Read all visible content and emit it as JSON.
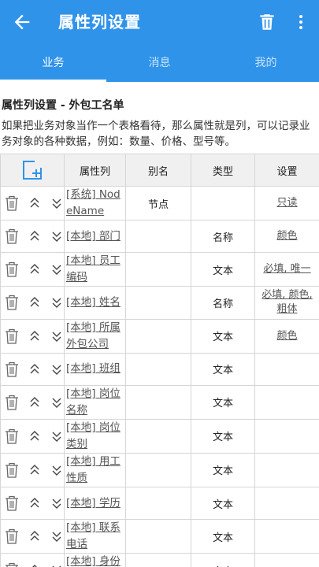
{
  "appbar": {
    "title": "属性列设置"
  },
  "tabs": [
    {
      "label": "业务",
      "active": true
    },
    {
      "label": "消息",
      "active": false
    },
    {
      "label": "我的",
      "active": false
    }
  ],
  "heading": "属性列设置 - 外包工名单",
  "description": "如果把业务对象当作一个表格看待，那么属性就是列，可以记录业务对象的各种数据，例如：数量、价格、型号等。",
  "table": {
    "headers": [
      "属性列",
      "别名",
      "类型",
      "设置"
    ],
    "rows": [
      {
        "name": "[系统] NodeName",
        "alias": "节点",
        "type": "",
        "settings": "只读"
      },
      {
        "name": "[本地] 部门",
        "alias": "",
        "type": "名称",
        "settings": "颜色"
      },
      {
        "name": "[本地] 员工编码",
        "alias": "",
        "type": "文本",
        "settings": "必填, 唯一"
      },
      {
        "name": "[本地] 姓名",
        "alias": "",
        "type": "名称",
        "settings": "必填, 颜色, 粗体"
      },
      {
        "name": "[本地] 所属外包公司",
        "alias": "",
        "type": "文本",
        "settings": "颜色"
      },
      {
        "name": "[本地] 班组",
        "alias": "",
        "type": "文本",
        "settings": ""
      },
      {
        "name": "[本地] 岗位名称",
        "alias": "",
        "type": "文本",
        "settings": ""
      },
      {
        "name": "[本地] 岗位类别",
        "alias": "",
        "type": "文本",
        "settings": ""
      },
      {
        "name": "[本地] 用工性质",
        "alias": "",
        "type": "文本",
        "settings": ""
      },
      {
        "name": "[本地] 学历",
        "alias": "",
        "type": "文本",
        "settings": ""
      },
      {
        "name": "[本地] 联系电话",
        "alias": "",
        "type": "文本",
        "settings": ""
      },
      {
        "name": "[本地] 身份证号",
        "alias": "",
        "type": "文本",
        "settings": ""
      }
    ]
  },
  "icons": {
    "back": "arrow-left-icon",
    "delete": "trash-icon",
    "more": "more-vert-icon",
    "add": "add-column-icon",
    "row_delete": "trash-icon",
    "move_up": "chevron-up-icon",
    "move_down": "chevron-down-icon"
  },
  "colors": {
    "primary": "#2f93ea",
    "accent": "#2f93ea",
    "link": "#555555",
    "header_bg": "#f0f0f0"
  }
}
